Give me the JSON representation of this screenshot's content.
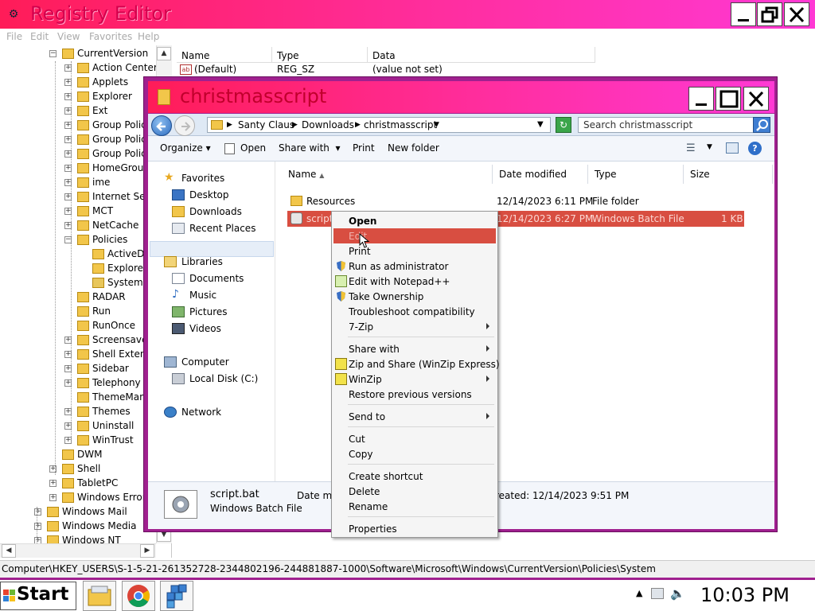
{
  "registry": {
    "title": "Registry Editor",
    "menu": [
      "File",
      "Edit",
      "View",
      "Favorites",
      "Help"
    ],
    "tree": [
      {
        "label": "CurrentVersion",
        "indent": 0,
        "exp": "-"
      },
      {
        "label": "Action Center",
        "indent": 1,
        "exp": "+"
      },
      {
        "label": "Applets",
        "indent": 1,
        "exp": "+"
      },
      {
        "label": "Explorer",
        "indent": 1,
        "exp": "+"
      },
      {
        "label": "Ext",
        "indent": 1,
        "exp": "+"
      },
      {
        "label": "Group Polic",
        "indent": 1,
        "exp": "+"
      },
      {
        "label": "Group Polic",
        "indent": 1,
        "exp": "+"
      },
      {
        "label": "Group Polic",
        "indent": 1,
        "exp": "+"
      },
      {
        "label": "HomeGroup",
        "indent": 1,
        "exp": "+"
      },
      {
        "label": "ime",
        "indent": 1,
        "exp": "+"
      },
      {
        "label": "Internet Setti",
        "indent": 1,
        "exp": "+"
      },
      {
        "label": "MCT",
        "indent": 1,
        "exp": "+"
      },
      {
        "label": "NetCache",
        "indent": 1,
        "exp": "+"
      },
      {
        "label": "Policies",
        "indent": 1,
        "exp": "-"
      },
      {
        "label": "ActiveDe",
        "indent": 2,
        "exp": ""
      },
      {
        "label": "Explorer",
        "indent": 2,
        "exp": ""
      },
      {
        "label": "System",
        "indent": 2,
        "exp": "",
        "selected": true
      },
      {
        "label": "RADAR",
        "indent": 1,
        "exp": ""
      },
      {
        "label": "Run",
        "indent": 1,
        "exp": ""
      },
      {
        "label": "RunOnce",
        "indent": 1,
        "exp": ""
      },
      {
        "label": "Screensaver",
        "indent": 1,
        "exp": "+"
      },
      {
        "label": "Shell Extens",
        "indent": 1,
        "exp": "+"
      },
      {
        "label": "Sidebar",
        "indent": 1,
        "exp": "+"
      },
      {
        "label": "Telephony",
        "indent": 1,
        "exp": "+"
      },
      {
        "label": "ThemeMan",
        "indent": 1,
        "exp": ""
      },
      {
        "label": "Themes",
        "indent": 1,
        "exp": "+"
      },
      {
        "label": "Uninstall",
        "indent": 1,
        "exp": "+"
      },
      {
        "label": "WinTrust",
        "indent": 1,
        "exp": "+"
      },
      {
        "label": "DWM",
        "indent": 0,
        "exp": ""
      },
      {
        "label": "Shell",
        "indent": 0,
        "exp": "+"
      },
      {
        "label": "TabletPC",
        "indent": 0,
        "exp": "+"
      },
      {
        "label": "Windows Error",
        "indent": 0,
        "exp": "+"
      },
      {
        "label": "Windows Mail",
        "indent": -1,
        "exp": "+"
      },
      {
        "label": "Windows Media",
        "indent": -1,
        "exp": "+"
      },
      {
        "label": "Windows NT",
        "indent": -1,
        "exp": "+"
      }
    ],
    "columns": {
      "name": "Name",
      "type": "Type",
      "data": "Data"
    },
    "value_row": {
      "name": "(Default)",
      "type": "REG_SZ",
      "data": "(value not set)"
    },
    "status": "Computer\\HKEY_USERS\\S-1-5-21-261352728-2344802196-244881887-1000\\Software\\Microsoft\\Windows\\CurrentVersion\\Policies\\System"
  },
  "explorer": {
    "title": "christmasscript",
    "breadcrumbs": [
      "Santy Claus",
      "Downloads",
      "christmasscript"
    ],
    "search_placeholder": "Search christmasscript",
    "commands": {
      "organize": "Organize",
      "open": "Open",
      "share": "Share with",
      "print": "Print",
      "new_folder": "New folder"
    },
    "nav": {
      "favorites": "Favorites",
      "desktop": "Desktop",
      "downloads": "Downloads",
      "recent": "Recent Places",
      "libraries": "Libraries",
      "documents": "Documents",
      "music": "Music",
      "pictures": "Pictures",
      "videos": "Videos",
      "computer": "Computer",
      "local_disk": "Local Disk (C:)",
      "network": "Network"
    },
    "columns": {
      "name": "Name",
      "date": "Date modified",
      "type": "Type",
      "size": "Size"
    },
    "files": [
      {
        "name": "Resources",
        "date": "12/14/2023 6:11 PM",
        "type": "File folder",
        "size": ""
      },
      {
        "name": "script.",
        "date": "12/14/2023 6:27 PM",
        "type": "Windows Batch File",
        "size": "1 KB"
      }
    ],
    "details": {
      "name": "script.bat",
      "type": "Windows Batch File",
      "date_label": "Date mo",
      "created": "reated: 12/14/2023 9:51 PM"
    }
  },
  "context_menu": {
    "open": "Open",
    "edit": "Edit",
    "print": "Print",
    "run_admin": "Run as administrator",
    "notepad": "Edit with Notepad++",
    "take_ownership": "Take Ownership",
    "troubleshoot": "Troubleshoot compatibility",
    "zip7": "7-Zip",
    "share_with": "Share with",
    "zip_share": "Zip and Share (WinZip Express)",
    "winzip": "WinZip",
    "restore": "Restore previous versions",
    "send_to": "Send to",
    "cut": "Cut",
    "copy": "Copy",
    "create_shortcut": "Create shortcut",
    "delete": "Delete",
    "rename": "Rename",
    "properties": "Properties"
  },
  "taskbar": {
    "start": "Start",
    "clock": "10:03 PM"
  },
  "colors": {
    "titlebar": "#ff2ea0",
    "window_frame": "#a0208f",
    "highlight": "#d84e41",
    "selection": "#d84e41"
  }
}
